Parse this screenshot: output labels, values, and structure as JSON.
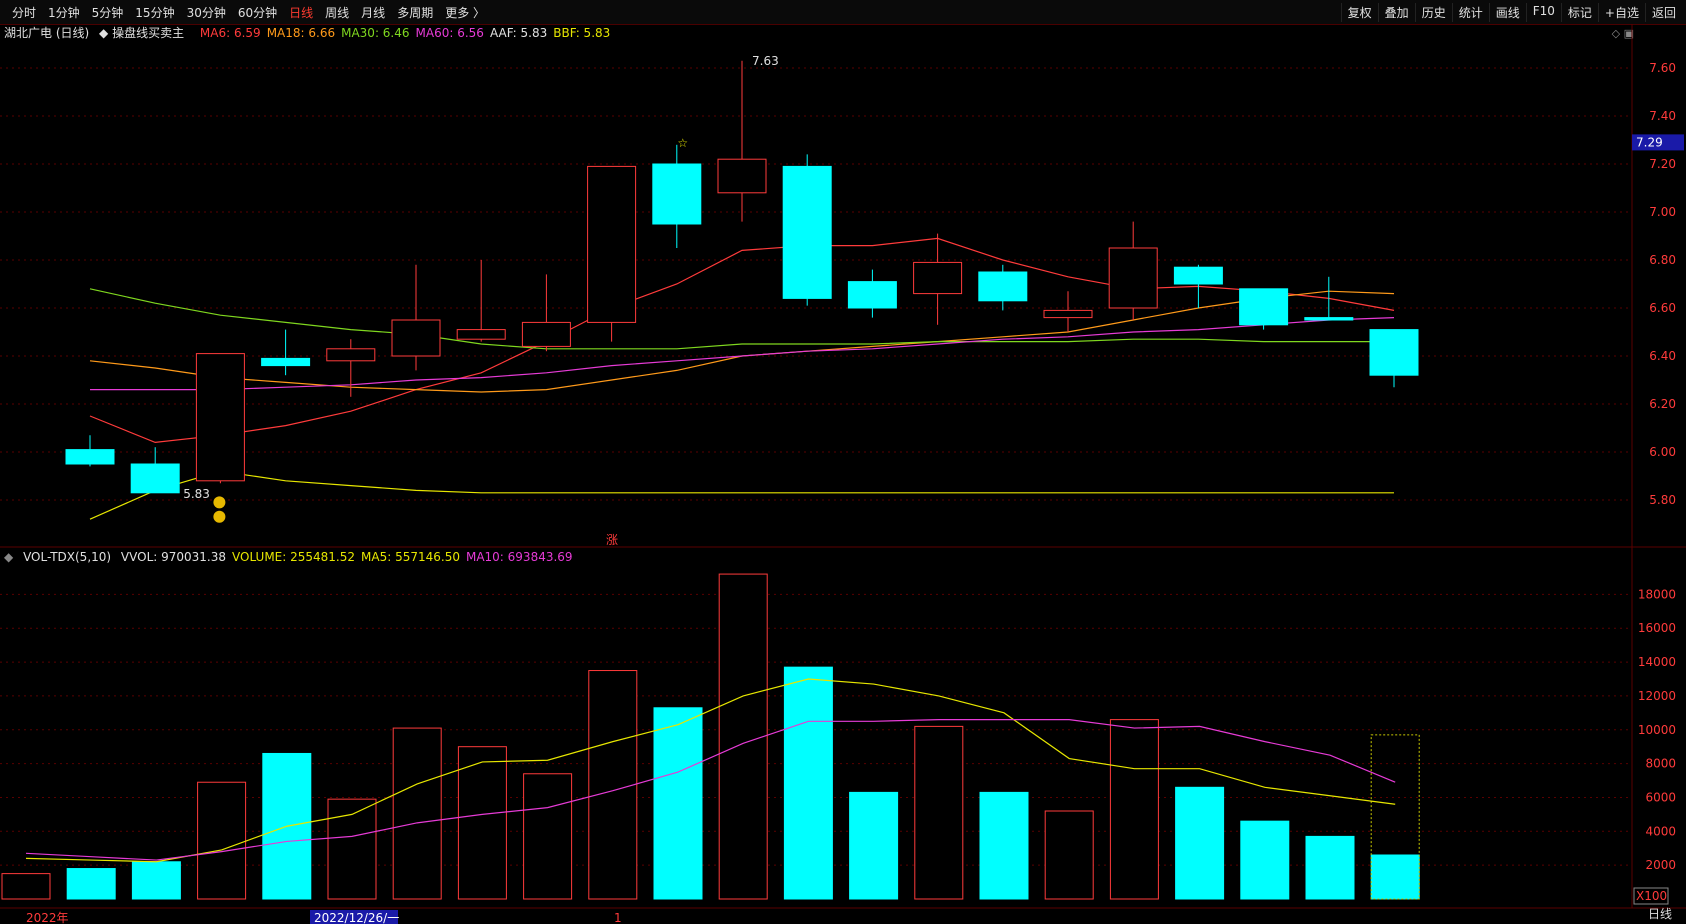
{
  "toolbar": {
    "tabs": [
      "分时",
      "1分钟",
      "5分钟",
      "15分钟",
      "30分钟",
      "60分钟",
      "日线",
      "周线",
      "月线",
      "多周期",
      "更多 〉"
    ],
    "active_tab": "日线",
    "right_buttons": [
      "复权",
      "叠加",
      "历史",
      "统计",
      "画线",
      "F10",
      "标记",
      "+自选",
      "返回"
    ]
  },
  "price_legend": {
    "stock": "湖北广电 (日线)",
    "indicator": "操盘线买卖主",
    "items": [
      {
        "text": "MA6: 6.59",
        "color": "#ff3b3b"
      },
      {
        "text": "MA18: 6.66",
        "color": "#ff9a1a"
      },
      {
        "text": "MA30: 6.46",
        "color": "#7fd71f"
      },
      {
        "text": "MA60: 6.56",
        "color": "#e63bd6"
      },
      {
        "text": "AAF: 5.83",
        "color": "#e0e0e0"
      },
      {
        "text": "BBF: 5.83",
        "color": "#e6e600"
      }
    ]
  },
  "vol_legend": {
    "indicator": "VOL-TDX(5,10)",
    "items": [
      {
        "text": "VVOL: 970031.38",
        "color": "#e0e0e0"
      },
      {
        "text": "VOLUME: 255481.52",
        "color": "#e6e600"
      },
      {
        "text": "MA5: 557146.50",
        "color": "#e6e600"
      },
      {
        "text": "MA10: 693843.69",
        "color": "#e63bd6"
      }
    ]
  },
  "annotations": {
    "high_label": "7.63",
    "low_label": "5.83",
    "current_price": "7.29",
    "zhang_marker": "涨",
    "star_marker": "☆",
    "vol_unit": "X100",
    "period_label": "日线"
  },
  "x_axis_labels": [
    "2022年",
    "2022/12/26/一",
    "1"
  ],
  "price_axis_ticks": [
    "7.60",
    "7.40",
    "7.20",
    "7.00",
    "6.80",
    "6.60",
    "6.40",
    "6.20",
    "6.00",
    "5.80"
  ],
  "vol_axis_ticks": [
    "18000",
    "16000",
    "14000",
    "12000",
    "10000",
    "8000",
    "6000",
    "4000",
    "2000"
  ],
  "colors": {
    "up": "#ff3b3b",
    "down": "#00ffff",
    "grid": "#5a0000",
    "axis_text": "#ff3b3b"
  },
  "chart_data": [
    {
      "type": "candlestick",
      "title": "湖北广电 (日线)",
      "ylim": [
        5.7,
        7.7
      ],
      "candles": [
        {
          "o": 6.01,
          "c": 5.95,
          "h": 6.07,
          "l": 5.94
        },
        {
          "o": 5.95,
          "c": 5.83,
          "h": 6.02,
          "l": 5.83
        },
        {
          "o": 5.88,
          "c": 6.41,
          "h": 6.41,
          "l": 5.87
        },
        {
          "o": 6.39,
          "c": 6.36,
          "h": 6.51,
          "l": 6.32
        },
        {
          "o": 6.38,
          "c": 6.43,
          "h": 6.47,
          "l": 6.23
        },
        {
          "o": 6.4,
          "c": 6.55,
          "h": 6.78,
          "l": 6.34
        },
        {
          "o": 6.47,
          "c": 6.51,
          "h": 6.8,
          "l": 6.46
        },
        {
          "o": 6.44,
          "c": 6.54,
          "h": 6.74,
          "l": 6.42
        },
        {
          "o": 6.54,
          "c": 7.19,
          "h": 7.19,
          "l": 6.46
        },
        {
          "o": 7.2,
          "c": 6.95,
          "h": 7.28,
          "l": 6.85
        },
        {
          "o": 7.08,
          "c": 7.22,
          "h": 7.63,
          "l": 6.96
        },
        {
          "o": 7.19,
          "c": 6.64,
          "h": 7.24,
          "l": 6.61
        },
        {
          "o": 6.71,
          "c": 6.6,
          "h": 6.76,
          "l": 6.56
        },
        {
          "o": 6.66,
          "c": 6.79,
          "h": 6.91,
          "l": 6.53
        },
        {
          "o": 6.75,
          "c": 6.63,
          "h": 6.78,
          "l": 6.59
        },
        {
          "o": 6.56,
          "c": 6.59,
          "h": 6.67,
          "l": 6.5
        },
        {
          "o": 6.6,
          "c": 6.85,
          "h": 6.96,
          "l": 6.55
        },
        {
          "o": 6.77,
          "c": 6.7,
          "h": 6.78,
          "l": 6.6
        },
        {
          "o": 6.68,
          "c": 6.53,
          "h": 6.68,
          "l": 6.51
        },
        {
          "o": 6.56,
          "c": 6.55,
          "h": 6.73,
          "l": 6.55
        },
        {
          "o": 6.51,
          "c": 6.32,
          "h": 6.51,
          "l": 6.27
        }
      ],
      "series": [
        {
          "name": "MA6",
          "color": "#ff3b3b",
          "values": [
            6.15,
            6.04,
            6.07,
            6.11,
            6.17,
            6.26,
            6.33,
            6.46,
            6.6,
            6.7,
            6.84,
            6.86,
            6.86,
            6.89,
            6.8,
            6.73,
            6.68,
            6.69,
            6.67,
            6.64,
            6.59
          ]
        },
        {
          "name": "MA18",
          "color": "#ff9a1a",
          "values": [
            6.38,
            6.35,
            6.31,
            6.29,
            6.27,
            6.26,
            6.25,
            6.26,
            6.3,
            6.34,
            6.4,
            6.42,
            6.44,
            6.46,
            6.48,
            6.5,
            6.55,
            6.6,
            6.64,
            6.67,
            6.66
          ]
        },
        {
          "name": "MA30",
          "color": "#7fd71f",
          "values": [
            6.68,
            6.62,
            6.57,
            6.54,
            6.51,
            6.49,
            6.45,
            6.43,
            6.43,
            6.43,
            6.45,
            6.45,
            6.45,
            6.46,
            6.46,
            6.46,
            6.47,
            6.47,
            6.46,
            6.46,
            6.46
          ]
        },
        {
          "name": "MA60",
          "color": "#e63bd6",
          "values": [
            6.26,
            6.26,
            6.26,
            6.27,
            6.28,
            6.3,
            6.31,
            6.33,
            6.36,
            6.38,
            6.4,
            6.42,
            6.43,
            6.45,
            6.47,
            6.48,
            6.5,
            6.51,
            6.53,
            6.55,
            6.56
          ]
        },
        {
          "name": "BBF",
          "color": "#e6e600",
          "values": [
            5.72,
            5.84,
            5.92,
            5.88,
            5.86,
            5.84,
            5.83,
            5.83,
            5.83,
            5.83,
            5.83,
            5.83,
            5.83,
            5.83,
            5.83,
            5.83,
            5.83,
            5.83,
            5.83,
            5.83,
            5.83
          ]
        }
      ]
    },
    {
      "type": "bar",
      "title": "VOL-TDX(5,10)",
      "ylim": [
        0,
        19500
      ],
      "unit": "X100",
      "values": [
        1500,
        1800,
        2200,
        6900,
        8600,
        5900,
        10100,
        9000,
        7400,
        13500,
        11300,
        19200,
        13700,
        6300,
        10200,
        6300,
        5200,
        10600,
        6600,
        4600,
        3700,
        2600
      ],
      "up": [
        true,
        false,
        false,
        true,
        false,
        true,
        true,
        true,
        true,
        true,
        false,
        true,
        false,
        false,
        true,
        false,
        true,
        true,
        false,
        false,
        false,
        false
      ],
      "series": [
        {
          "name": "MA5",
          "color": "#e6e600",
          "values": [
            2400,
            2300,
            2200,
            2900,
            4300,
            5000,
            6800,
            8100,
            8200,
            9300,
            10300,
            12000,
            13000,
            12700,
            12000,
            11000,
            8300,
            7700,
            7700,
            6600,
            6100,
            5600
          ]
        },
        {
          "name": "MA10",
          "color": "#e63bd6",
          "values": [
            2700,
            2500,
            2300,
            2800,
            3400,
            3700,
            4500,
            5000,
            5400,
            6400,
            7500,
            9200,
            10500,
            10500,
            10600,
            10600,
            10600,
            10100,
            10200,
            9300,
            8500,
            6900
          ]
        }
      ]
    }
  ]
}
